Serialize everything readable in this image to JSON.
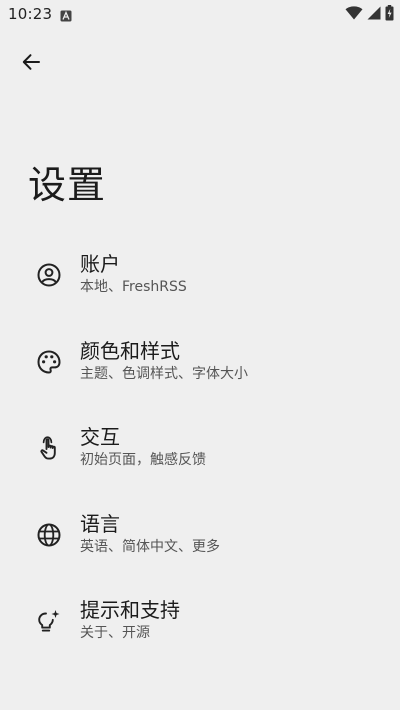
{
  "status_bar": {
    "time": "10:23",
    "notification_icon": "font-a-icon",
    "right_icons": [
      "wifi-icon",
      "signal-icon",
      "battery-charging-icon"
    ]
  },
  "header": {
    "back_icon": "arrow-left-icon"
  },
  "page": {
    "title": "设置"
  },
  "settings": {
    "items": [
      {
        "title": "账户",
        "subtitle": "本地、FreshRSS",
        "icon": "account-circle-icon"
      },
      {
        "title": "颜色和样式",
        "subtitle": "主题、色调样式、字体大小",
        "icon": "palette-icon"
      },
      {
        "title": "交互",
        "subtitle": "初始页面，触感反馈",
        "icon": "touch-gesture-icon"
      },
      {
        "title": "语言",
        "subtitle": "英语、简体中文、更多",
        "icon": "globe-icon"
      },
      {
        "title": "提示和支持",
        "subtitle": "关于、开源",
        "icon": "lightbulb-sparkle-icon"
      }
    ]
  },
  "colors": {
    "background": "#efefef",
    "text_primary": "#1b1b1b",
    "text_secondary": "#555555"
  }
}
